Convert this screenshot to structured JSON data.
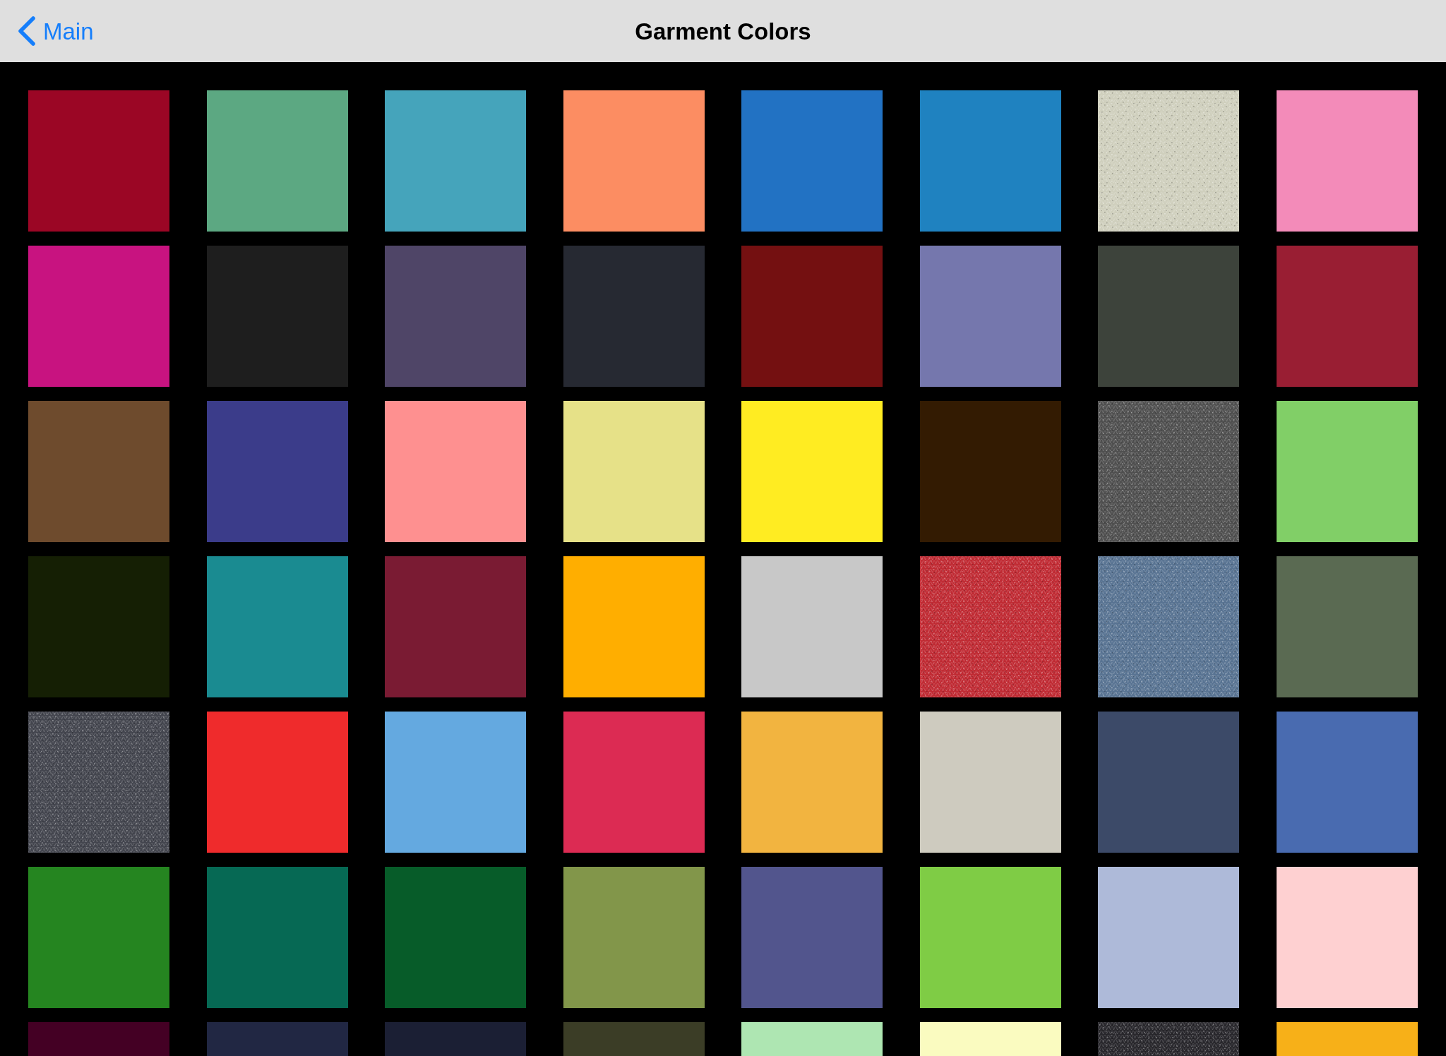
{
  "nav_bar": {
    "back_button": {
      "label": "Main"
    },
    "title": "Garment Colors"
  },
  "swatches": [
    {
      "kind": "solid",
      "color": "#9b0625"
    },
    {
      "kind": "solid",
      "color": "#5ca882"
    },
    {
      "kind": "solid",
      "color": "#45a4bb"
    },
    {
      "kind": "solid",
      "color": "#fc8d62"
    },
    {
      "kind": "solid",
      "color": "#2272c3"
    },
    {
      "kind": "solid",
      "color": "#1f82c0"
    },
    {
      "kind": "heather",
      "color": "#cfcfbd"
    },
    {
      "kind": "solid",
      "color": "#f38bb9"
    },
    {
      "kind": "solid",
      "color": "#c81380"
    },
    {
      "kind": "solid",
      "color": "#1e1e1e"
    },
    {
      "kind": "solid",
      "color": "#4f4567"
    },
    {
      "kind": "solid",
      "color": "#262932"
    },
    {
      "kind": "solid",
      "color": "#741011"
    },
    {
      "kind": "solid",
      "color": "#7577ad"
    },
    {
      "kind": "solid",
      "color": "#3d433b"
    },
    {
      "kind": "solid",
      "color": "#991e33"
    },
    {
      "kind": "solid",
      "color": "#6e4b2d"
    },
    {
      "kind": "solid",
      "color": "#3b3c8a"
    },
    {
      "kind": "solid",
      "color": "#fe9090"
    },
    {
      "kind": "solid",
      "color": "#e6e188"
    },
    {
      "kind": "solid",
      "color": "#ffec22"
    },
    {
      "kind": "solid",
      "color": "#331b02"
    },
    {
      "kind": "heather",
      "color": "#4f4f4f"
    },
    {
      "kind": "solid",
      "color": "#81cf67"
    },
    {
      "kind": "solid",
      "color": "#151f04"
    },
    {
      "kind": "solid",
      "color": "#1a8b91"
    },
    {
      "kind": "solid",
      "color": "#7a1b33"
    },
    {
      "kind": "solid",
      "color": "#ffae00"
    },
    {
      "kind": "solid",
      "color": "#c8c8c8"
    },
    {
      "kind": "heather",
      "color": "#c02a33"
    },
    {
      "kind": "heather",
      "color": "#587392"
    },
    {
      "kind": "solid",
      "color": "#5a6a52"
    },
    {
      "kind": "heather",
      "color": "#43454e"
    },
    {
      "kind": "solid",
      "color": "#ef2b2c"
    },
    {
      "kind": "solid",
      "color": "#64a9e0"
    },
    {
      "kind": "solid",
      "color": "#dc2b53"
    },
    {
      "kind": "solid",
      "color": "#f2b440"
    },
    {
      "kind": "solid",
      "color": "#cecbbf"
    },
    {
      "kind": "solid",
      "color": "#3c4a68"
    },
    {
      "kind": "solid",
      "color": "#496bb0"
    },
    {
      "kind": "solid",
      "color": "#258520"
    },
    {
      "kind": "solid",
      "color": "#066954"
    },
    {
      "kind": "solid",
      "color": "#075c29"
    },
    {
      "kind": "solid",
      "color": "#82964a"
    },
    {
      "kind": "solid",
      "color": "#52558d"
    },
    {
      "kind": "solid",
      "color": "#7fcc45"
    },
    {
      "kind": "solid",
      "color": "#aebad9"
    },
    {
      "kind": "solid",
      "color": "#fed0d1"
    },
    {
      "kind": "solid",
      "color": "#440024"
    },
    {
      "kind": "solid",
      "color": "#212743"
    },
    {
      "kind": "solid",
      "color": "#1b1f34"
    },
    {
      "kind": "solid",
      "color": "#3b3d26"
    },
    {
      "kind": "solid",
      "color": "#aee6b2"
    },
    {
      "kind": "solid",
      "color": "#fafbc0"
    },
    {
      "kind": "heather",
      "color": "#28272c"
    },
    {
      "kind": "solid",
      "color": "#f7b018"
    }
  ]
}
